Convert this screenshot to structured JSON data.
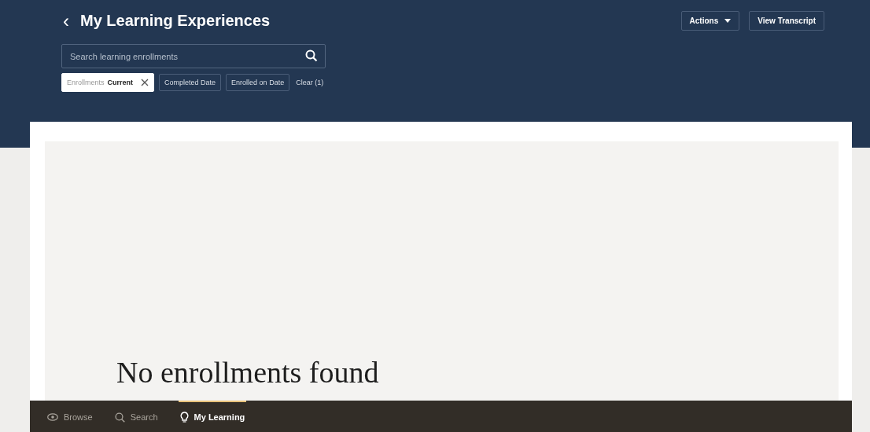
{
  "header": {
    "back": "‹",
    "title": "My Learning Experiences",
    "actions": [
      {
        "label": "Actions",
        "kind": "menu"
      },
      {
        "label": "View Transcript",
        "kind": "plain"
      }
    ]
  },
  "search": {
    "placeholder": "Search learning enrollments"
  },
  "filters": [
    {
      "kind": "applied",
      "label": "Enrollments",
      "value": "Current"
    },
    {
      "kind": "option",
      "label": "Completed Date"
    },
    {
      "kind": "option",
      "label": "Enrolled on Date"
    },
    {
      "kind": "clear",
      "label": "Clear (1)"
    }
  ],
  "empty_message": "No enrollments found",
  "nav": [
    {
      "label": "Browse",
      "selected": false
    },
    {
      "label": "Search",
      "selected": false
    },
    {
      "label": "My Learning",
      "selected": true
    }
  ]
}
